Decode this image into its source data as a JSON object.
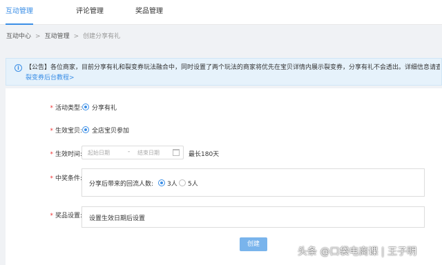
{
  "topnav": {
    "tabs": [
      {
        "label": "互动管理",
        "active": true
      },
      {
        "label": "评论管理",
        "active": false
      },
      {
        "label": "奖品管理",
        "active": false
      }
    ]
  },
  "breadcrumb": {
    "items": [
      "互动中心",
      "互动管理",
      "创建分享有礼"
    ],
    "separator": ">"
  },
  "notice": {
    "icon": "info-icon",
    "text_line1": "【公告】各位商家，目前分享有礼和裂变券玩法融合中，同时设置了两个玩法的商家将优先在宝贝详情内展示裂变券，分享有礼不会透出。详细信息请查看",
    "text_line2": "裂变券后台教程>"
  },
  "form": {
    "required_mark": "*",
    "activity_type": {
      "label": "活动类型:",
      "option": "分享有礼",
      "checked": true
    },
    "effective_item": {
      "label": "生效宝贝:",
      "option": "全店宝贝参加",
      "checked": true
    },
    "effective_time": {
      "label": "生效时间:",
      "start_placeholder": "起始日期",
      "separator": "-",
      "end_placeholder": "结束日期",
      "note": "最长180天"
    },
    "win_condition": {
      "label": "中奖条件:",
      "prompt": "分享后带来的回流人数:",
      "options": [
        {
          "label": "3人",
          "checked": true
        },
        {
          "label": "5人",
          "checked": false
        }
      ]
    },
    "prize_settings": {
      "label": "奖品设置:",
      "text": "设置生效日期后设置"
    },
    "create_button": "创建"
  },
  "watermark": "头条 @口袋电商课 | 王子明",
  "colors": {
    "accent": "#3a8ee6",
    "notice_bg": "#e6f2fb",
    "button_bg": "#79b4ec",
    "required": "#e33333"
  }
}
